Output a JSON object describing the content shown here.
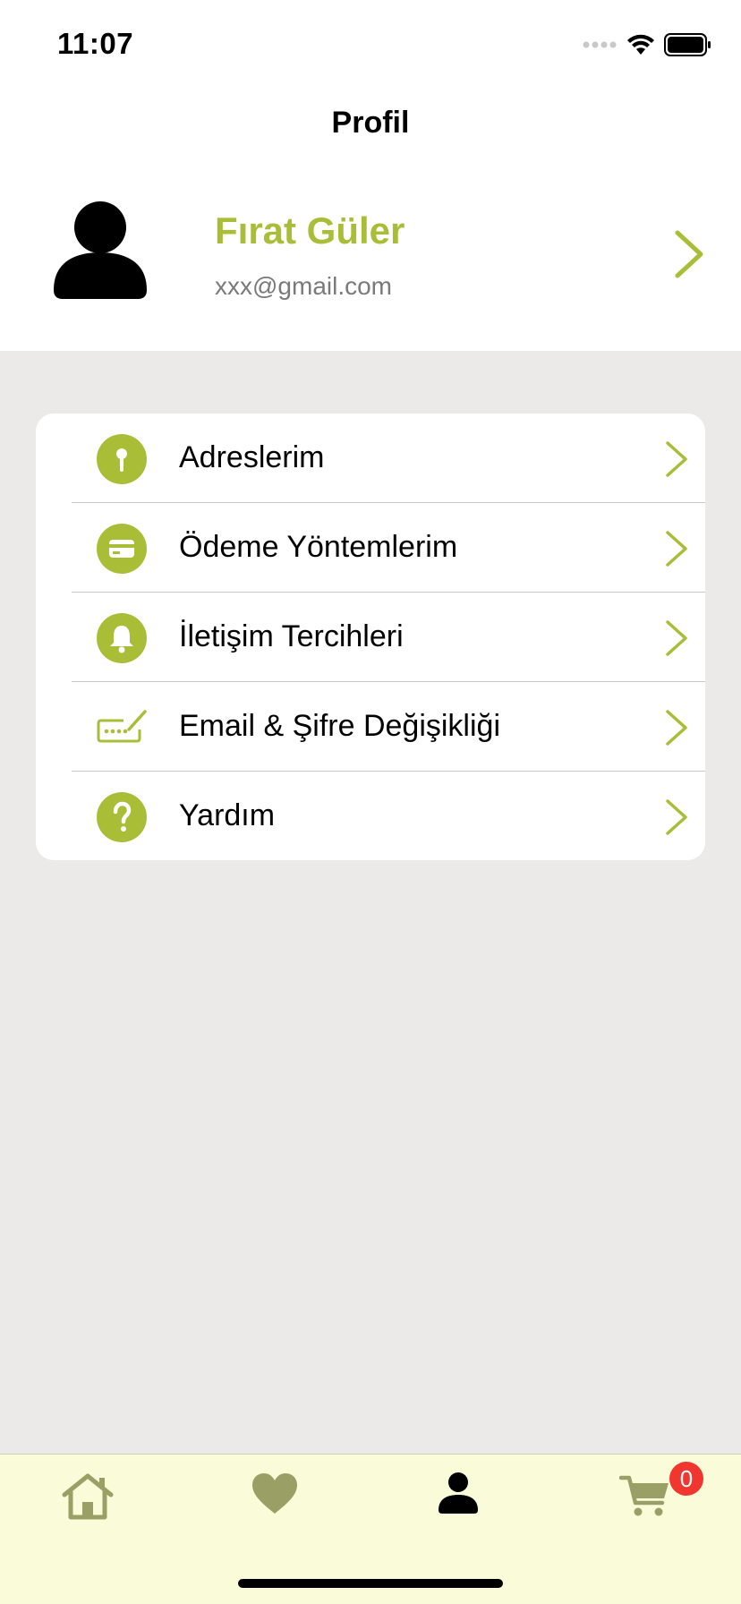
{
  "status_bar": {
    "time": "11:07"
  },
  "header": {
    "title": "Profil"
  },
  "profile": {
    "name": "Fırat Güler",
    "email": "xxx@gmail.com"
  },
  "menu": {
    "items": [
      {
        "label": "Adreslerim",
        "icon": "location-pin-icon"
      },
      {
        "label": "Ödeme Yöntemlerim",
        "icon": "credit-card-icon"
      },
      {
        "label": "İletişim Tercihleri",
        "icon": "bell-icon"
      },
      {
        "label": "Email & Şifre Değişikliği",
        "icon": "password-edit-icon"
      },
      {
        "label": "Yardım",
        "icon": "help-icon"
      }
    ]
  },
  "tab_bar": {
    "items": [
      "home-icon",
      "heart-icon",
      "profile-icon",
      "cart-icon"
    ],
    "active": "profile-icon",
    "cart_count": "0"
  },
  "colors": {
    "accent": "#a9bd37",
    "tab_bar_bg": "#fafcd9",
    "tab_inactive": "#9aa065",
    "badge": "#f0362e",
    "page_bg": "#ebeae8"
  }
}
